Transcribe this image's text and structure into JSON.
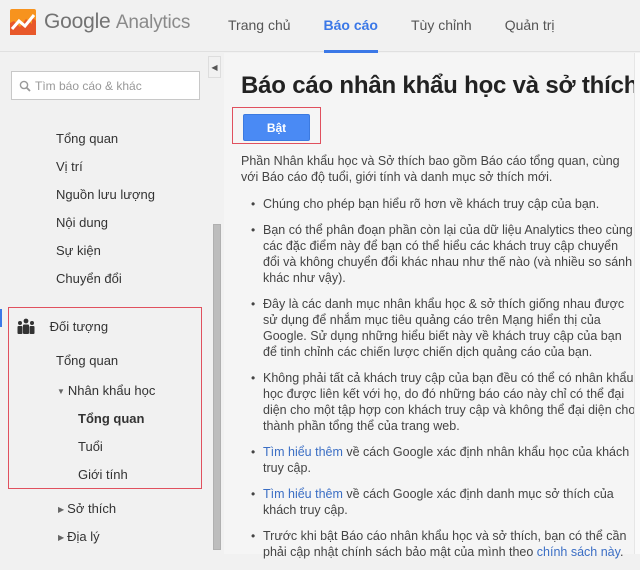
{
  "header": {
    "logo_brand": "Google",
    "logo_product": "Analytics",
    "brand_color": "#f57c00",
    "nav_tabs": [
      {
        "label": "Trang chủ",
        "active": false
      },
      {
        "label": "Báo cáo",
        "active": true
      },
      {
        "label": "Tùy chỉnh",
        "active": false
      },
      {
        "label": "Quản trị",
        "active": false
      }
    ],
    "accent_color": "#3b78e7"
  },
  "sidebar": {
    "search_placeholder": "Tìm báo cáo & khác",
    "items": [
      {
        "label": "Tổng quan"
      },
      {
        "label": "Vị trí"
      },
      {
        "label": "Nguồn lưu lượng"
      },
      {
        "label": "Nội dung"
      },
      {
        "label": "Sự kiện"
      },
      {
        "label": "Chuyển đổi"
      }
    ],
    "audience": {
      "label": "Đối tượng",
      "overview": "Tổng quan",
      "demographics": {
        "label": "Nhân khẩu học",
        "expanded": true,
        "children": [
          {
            "label": "Tổng quan",
            "selected": true
          },
          {
            "label": "Tuổi",
            "selected": false
          },
          {
            "label": "Giới tính",
            "selected": false
          }
        ]
      },
      "interests": {
        "label": "Sở thích",
        "expanded": false
      },
      "geo": {
        "label": "Địa lý",
        "expanded": false
      }
    }
  },
  "main": {
    "title": "Báo cáo nhân khẩu học và sở thích",
    "enable_button": "Bật",
    "intro": "Phần Nhân khẩu học và Sở thích bao gồm Báo cáo tổng quan, cùng với Báo cáo độ tuổi, giới tính và danh mục sở thích mới.",
    "bullets": [
      {
        "text": "Chúng cho phép bạn hiểu rõ hơn về khách truy cập của bạn."
      },
      {
        "text": "Bạn có thể phân đoạn phần còn lại của dữ liệu Analytics theo cùng các đặc điểm này để bạn có thể hiểu các khách truy cập chuyển đổi và không chuyển đổi khác nhau như thế nào (và nhiều so sánh khác như vậy)."
      },
      {
        "text": "Đây là các danh mục nhân khẩu học & sở thích giống nhau được sử dụng để nhắm mục tiêu quảng cáo trên Mạng hiển thị của Google. Sử dụng những hiểu biết này về khách truy cập của bạn để tinh chỉnh các chiến lược chiến dịch quảng cáo của bạn."
      },
      {
        "text": "Không phải tất cả khách truy cập của bạn đều có thể có nhân khẩu học được liên kết với họ, do đó những báo cáo này chỉ có thể đại diện cho một tập hợp con khách truy cập và không thể đại diện cho thành phần tổng thể của trang web."
      },
      {
        "link": "Tìm hiểu thêm",
        "text": " về cách Google xác định nhân khẩu học của khách truy cập."
      },
      {
        "link": "Tìm hiểu thêm",
        "text": " về cách Google xác định danh mục sở thích của khách truy cập."
      },
      {
        "text": "Trước khi bật Báo cáo nhân khẩu học và sở thích, bạn có thể cần phải cập nhật chính sách bảo mật của mình theo ",
        "trailing_link": "chính sách này",
        "trailing_text": "."
      }
    ]
  }
}
